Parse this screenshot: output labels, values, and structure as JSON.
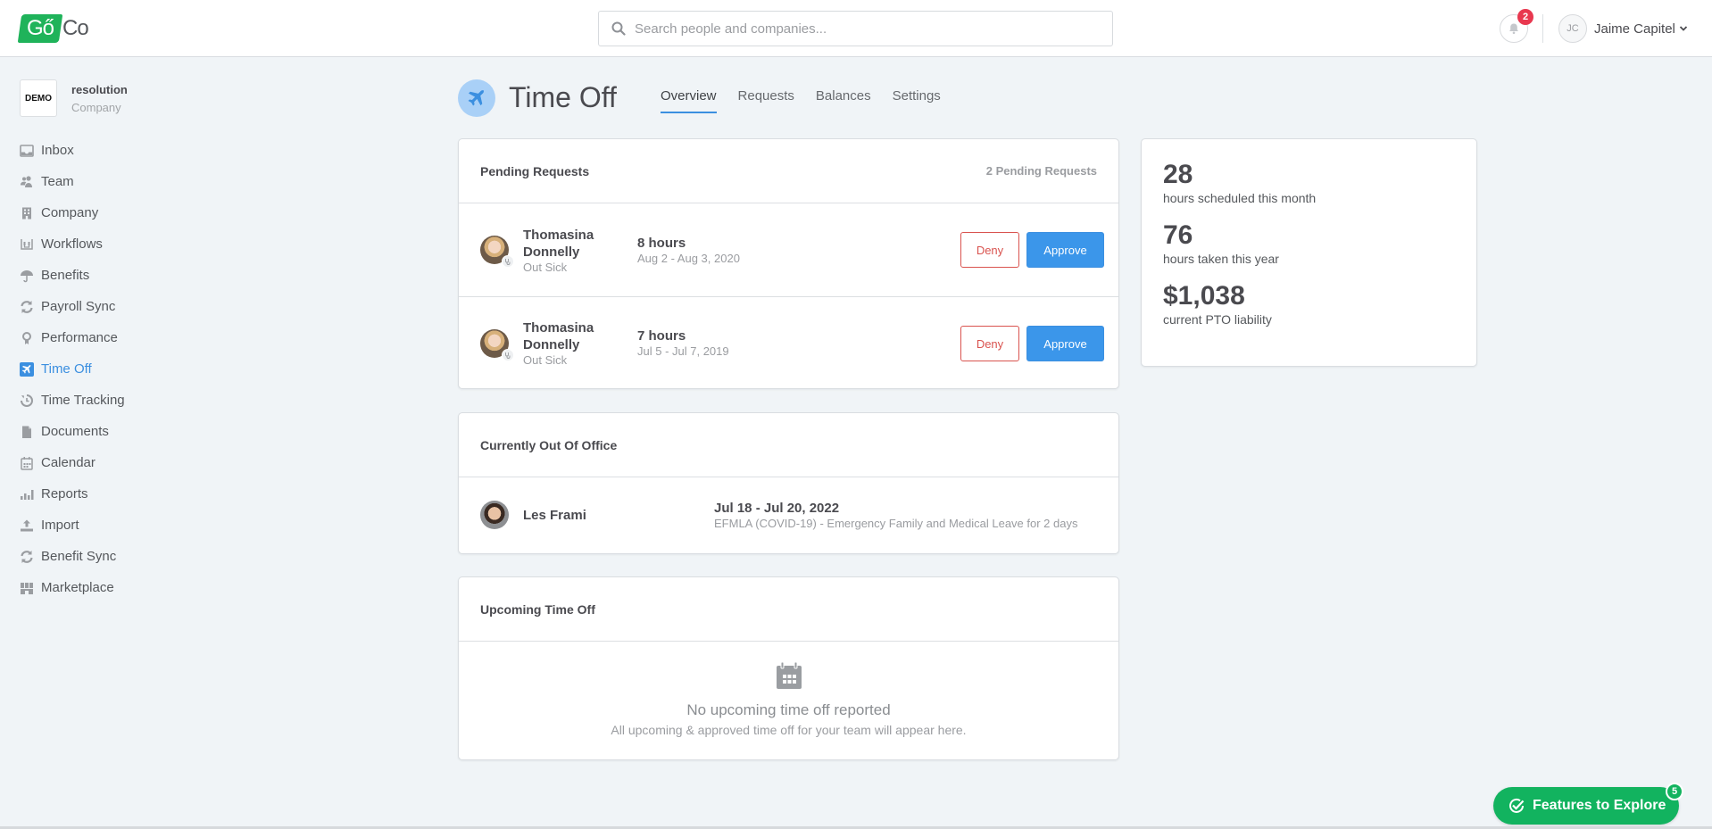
{
  "app": {
    "logo_left": "Gő",
    "logo_right": "Co",
    "brand_color": "#1fb35a",
    "accent_color": "#3b8fe0"
  },
  "header": {
    "search_placeholder": "Search people and companies...",
    "notification_count": "2",
    "user_initials": "JC",
    "user_name": "Jaime Capitel"
  },
  "company": {
    "logo_text": "DEMO",
    "name": "resolution",
    "type": "Company"
  },
  "sidebar": {
    "items": [
      {
        "label": "Inbox",
        "icon": "inbox-icon"
      },
      {
        "label": "Team",
        "icon": "team-icon"
      },
      {
        "label": "Company",
        "icon": "building-icon"
      },
      {
        "label": "Workflows",
        "icon": "workflow-icon"
      },
      {
        "label": "Benefits",
        "icon": "umbrella-icon"
      },
      {
        "label": "Payroll Sync",
        "icon": "sync-icon"
      },
      {
        "label": "Performance",
        "icon": "award-icon"
      },
      {
        "label": "Time Off",
        "icon": "airplane-icon",
        "active": true
      },
      {
        "label": "Time Tracking",
        "icon": "clock-icon"
      },
      {
        "label": "Documents",
        "icon": "document-icon"
      },
      {
        "label": "Calendar",
        "icon": "calendar-icon"
      },
      {
        "label": "Reports",
        "icon": "bar-chart-icon"
      },
      {
        "label": "Import",
        "icon": "upload-icon"
      },
      {
        "label": "Benefit Sync",
        "icon": "sync-icon"
      },
      {
        "label": "Marketplace",
        "icon": "marketplace-icon"
      }
    ]
  },
  "page": {
    "title": "Time Off",
    "tabs": [
      {
        "label": "Overview",
        "active": true
      },
      {
        "label": "Requests"
      },
      {
        "label": "Balances"
      },
      {
        "label": "Settings"
      }
    ]
  },
  "pending": {
    "title": "Pending Requests",
    "count_label": "2 Pending Requests",
    "deny_label": "Deny",
    "approve_label": "Approve",
    "requests": [
      {
        "name": "Thomasina Donnelly",
        "type": "Out Sick",
        "hours": "8 hours",
        "dates": "Aug 2 - Aug 3, 2020"
      },
      {
        "name": "Thomasina Donnelly",
        "type": "Out Sick",
        "hours": "7 hours",
        "dates": "Jul 5 - Jul 7, 2019"
      }
    ]
  },
  "out_of_office": {
    "title": "Currently Out Of Office",
    "people": [
      {
        "name": "Les Frami",
        "dates": "Jul 18 - Jul 20, 2022",
        "description": "EFMLA (COVID-19) - Emergency Family and Medical Leave for 2 days"
      }
    ]
  },
  "upcoming": {
    "title": "Upcoming Time Off",
    "empty_title": "No upcoming time off reported",
    "empty_subtitle": "All upcoming & approved time off for your team will appear here."
  },
  "stats": [
    {
      "value": "28",
      "label": "hours scheduled this month"
    },
    {
      "value": "76",
      "label": "hours taken this year"
    },
    {
      "value": "$1,038",
      "label": "current PTO liability"
    }
  ],
  "features": {
    "label": "Features to Explore",
    "count": "5"
  }
}
